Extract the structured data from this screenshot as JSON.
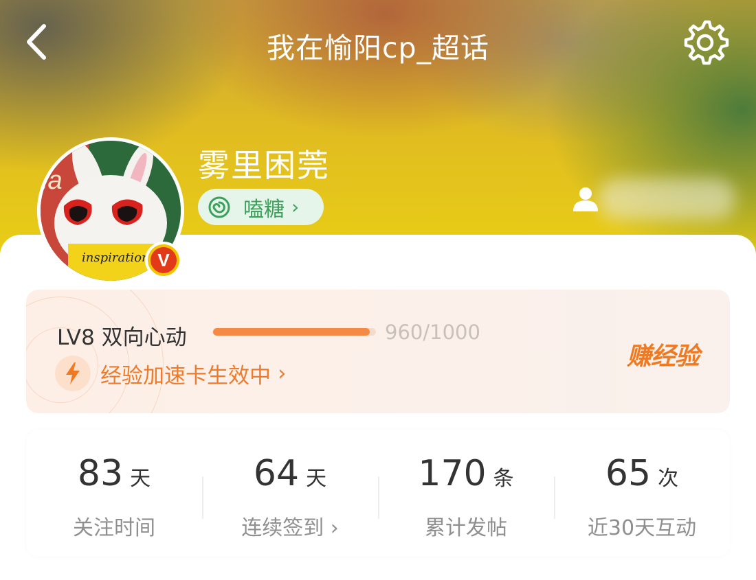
{
  "header": {
    "title": "我在愉阳cp_超话",
    "back_icon": "chevron-left-icon",
    "settings_icon": "gear-icon"
  },
  "profile": {
    "name": "雾里困莞",
    "tag_label": "嗑糖",
    "tag_chevron": "›",
    "avatar_text": "inspiration.",
    "verified_badge": "V",
    "verified_color": "#e23a18",
    "person_icon": "person-icon"
  },
  "level": {
    "label": "LV8 双向心动",
    "progress_text": "960/1000",
    "progress_value": 0.96,
    "boost_text": "经验加速卡生效中",
    "boost_chevron": "›",
    "earn_label": "赚经验",
    "accent_color": "#f58a45"
  },
  "stats": [
    {
      "value": "83",
      "unit": "天",
      "label": "关注时间"
    },
    {
      "value": "64",
      "unit": "天",
      "label": "连续签到 ›"
    },
    {
      "value": "170",
      "unit": "条",
      "label": "累计发帖"
    },
    {
      "value": "65",
      "unit": "次",
      "label": "近30天互动"
    }
  ]
}
